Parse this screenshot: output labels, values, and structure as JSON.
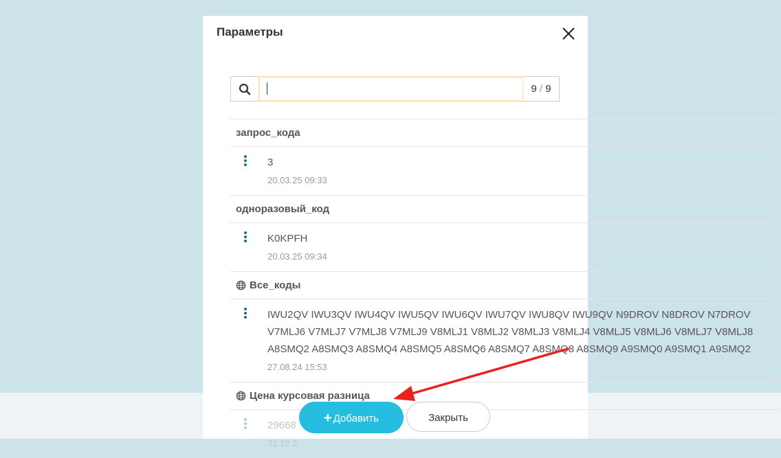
{
  "dialog": {
    "title": "Параметры"
  },
  "search": {
    "value": "",
    "count": "9",
    "total": "9",
    "separator": "/"
  },
  "groups": [
    {
      "name": "запрос_кода",
      "global": false,
      "entry": {
        "value_lines": [
          "3"
        ],
        "date": "20.03.25 09:33"
      }
    },
    {
      "name": "одноразовый_код",
      "global": false,
      "entry": {
        "value_lines": [
          "K0KPFH"
        ],
        "date": "20.03.25 09:34"
      }
    },
    {
      "name": "Все_коды",
      "global": true,
      "entry": {
        "value_lines": [
          "IWU2QV IWU3QV IWU4QV IWU5QV IWU6QV IWU7QV IWU8QV IWU9QV N9DROV N8DROV N7DROV",
          "V7MLJ6 V7MLJ7 V7MLJ8 V7MLJ9 V8MLJ1 V8MLJ2 V8MLJ3 V8MLJ4 V8MLJ5 V8MLJ6 V8MLJ7 V8MLJ8",
          "A8SMQ2 A8SMQ3 A8SMQ4 A8SMQ5 A8SMQ6 A8SMQ7 A8SMQ8 A8SMQ9 A9SMQ0 A9SMQ1 A9SMQ2"
        ],
        "date": "27.08.24 15:53"
      }
    },
    {
      "name": "Цена курсовая разница",
      "global": true,
      "entry": {
        "value_lines": [
          "29668"
        ],
        "date": "31.12.2"
      }
    }
  ],
  "footer": {
    "add_label": "Добавить",
    "close_label": "Закрыть"
  },
  "colors": {
    "background": "#cde3ea",
    "accent": "#25bde0",
    "kebab": "#1a6f8a",
    "annotation_arrow": "#e8211c"
  },
  "icons": {
    "close": "close-icon",
    "search": "search-icon",
    "globe": "globe-icon",
    "menu": "kebab-menu-icon",
    "plus": "plus-icon"
  }
}
